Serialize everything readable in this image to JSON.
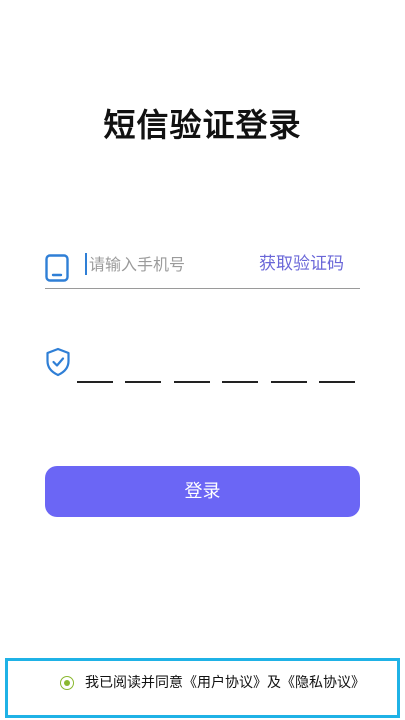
{
  "page": {
    "title": "短信验证登录"
  },
  "phone": {
    "placeholder": "请输入手机号",
    "value": ""
  },
  "verification": {
    "get_code_label": "获取验证码",
    "code_length": 6
  },
  "actions": {
    "login_label": "登录"
  },
  "agreement": {
    "text": "我已阅读并同意《用户协议》及《隐私协议》",
    "checked": true
  },
  "colors": {
    "accent": "#6b66f5",
    "link": "#6a67d8",
    "icon_blue": "#2f7fd6",
    "radio_green": "#8ab82f",
    "highlight_border": "#1fb2e6"
  },
  "icons": {
    "phone": "phone-icon",
    "shield": "shield-check-icon"
  }
}
